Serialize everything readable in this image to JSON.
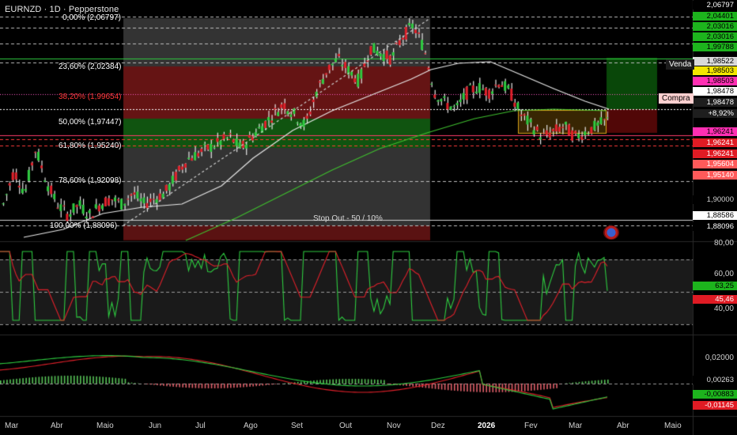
{
  "chart_title": "EURNZD · 1D · Pepperstone",
  "price_axis": {
    "labels": [
      "2,06797",
      "2,04401",
      "2,03016",
      "2,03016",
      "1,99788",
      "1,98522",
      "1,98503",
      "1,98503",
      "1,98478",
      "1,98478",
      "+8,92%",
      "1,96241",
      "1,96241",
      "1,96241",
      "1,95604",
      "1,95140",
      "1,90000",
      "1,88586",
      "1,88096"
    ]
  },
  "badges": [
    {
      "text": "2,06797",
      "bg": "#000000",
      "fg": "#ffffff"
    },
    {
      "text": "2,04401",
      "bg": "#1db41d",
      "fg": "#000000"
    },
    {
      "text": "2,03016",
      "bg": "#1db41d",
      "fg": "#000000"
    },
    {
      "text": "2,03016",
      "bg": "#1db41d",
      "fg": "#000000"
    },
    {
      "text": "1,99788",
      "bg": "#1db41d",
      "fg": "#000000"
    },
    {
      "text": "1,98522",
      "bg": "#d9d9d9",
      "fg": "#000000"
    },
    {
      "text": "1,98503",
      "bg": "#f3e600",
      "fg": "#000000"
    },
    {
      "text": "1,98503",
      "bg": "#ff2fb3",
      "fg": "#000000"
    },
    {
      "text": "1,98478",
      "bg": "#ffffff",
      "fg": "#000000"
    },
    {
      "text": "1,98478",
      "bg": "#1e1e1e",
      "fg": "#ffffff"
    },
    {
      "text": "+8,92%",
      "bg": "#1e1e1e",
      "fg": "#ffffff"
    },
    {
      "text": "1,96241",
      "bg": "#ff2fb3",
      "fg": "#000000"
    },
    {
      "text": "1,96241",
      "bg": "#e01b24",
      "fg": "#ffffff"
    },
    {
      "text": "1,96241",
      "bg": "#e01b24",
      "fg": "#ffffff"
    },
    {
      "text": "1,95604",
      "bg": "#ff5a5a",
      "fg": "#ffffff"
    },
    {
      "text": "1,95140",
      "bg": "#ff5a5a",
      "fg": "#ffffff"
    },
    {
      "text": "1,90000",
      "bg": "#000000",
      "fg": "#cfcfcf"
    },
    {
      "text": "1,88586",
      "bg": "#ffffff",
      "fg": "#000000"
    },
    {
      "text": "1,88096",
      "bg": "#000000",
      "fg": "#ffffff"
    }
  ],
  "tags": {
    "venda": "Venda",
    "compra": "Compra"
  },
  "fibo_labels": [
    "0,00% (2,06797)",
    "23,60% (2,02384)",
    "38,20% (1,99654)",
    "50,00% (1,97447)",
    "61,80% (1,95240)",
    "78,60% (1,92098)",
    "100,00% (1,88096)"
  ],
  "stop_out": "Stop Out - 50 / 10%",
  "rsi_axis": [
    "80,00",
    "60,00",
    "63,25",
    "45,46",
    "40,00"
  ],
  "macd_axis": [
    "0,02000",
    "0,00263",
    "-0,00883",
    "-0,01145"
  ],
  "months": [
    "Mar",
    "Abr",
    "Maio",
    "Jun",
    "Jul",
    "Ago",
    "Set",
    "Out",
    "Nov",
    "Dez",
    "2026",
    "Fev",
    "Mar",
    "Abr",
    "Maio"
  ],
  "colors": {
    "up": "#2ecc40",
    "down": "#e0202a",
    "ma_green": "#3fbf2f",
    "ma_white": "#e8e8e8",
    "rsi_green": "#2ecc40",
    "rsi_red": "#e0202a"
  },
  "chart_data": {
    "type": "candlestick",
    "title": "EURNZD · 1D · Pepperstone",
    "ylim": [
      1.875,
      2.075
    ],
    "months": [
      "Mar",
      "Abr",
      "Maio",
      "Jun",
      "Jul",
      "Ago",
      "Set",
      "Out",
      "Nov",
      "Dez",
      "2026",
      "Fev",
      "Mar",
      "Abr",
      "Maio"
    ],
    "price_path": [
      1.9,
      1.93,
      1.91,
      1.95,
      1.92,
      1.9,
      1.89,
      1.9,
      1.89,
      1.9,
      1.905,
      1.9,
      1.91,
      1.9,
      1.905,
      1.91,
      1.925,
      1.94,
      1.945,
      1.95,
      1.955,
      1.96,
      1.95,
      1.96,
      1.97,
      1.98,
      1.99,
      1.98,
      1.97,
      2.0,
      2.02,
      2.03,
      2.02,
      2.01,
      2.04,
      2.035,
      2.03,
      2.05,
      2.06,
      2.04,
      2.0,
      1.99,
      1.985,
      2.0,
      2.005,
      2.0,
      2.01,
      2.0,
      1.98,
      1.97,
      1.96,
      1.965,
      1.97,
      1.96,
      1.965,
      1.97,
      1.975
    ],
    "fib_levels": [
      2.06797,
      2.02384,
      1.99654,
      1.97447,
      1.9524,
      1.92098,
      1.88096
    ],
    "rsi": {
      "last": 63.25,
      "signal": 45.46,
      "levels": [
        70,
        50,
        30
      ]
    },
    "macd": {
      "last": 0.00263,
      "macd": -0.00883,
      "signal": -0.01145
    }
  }
}
